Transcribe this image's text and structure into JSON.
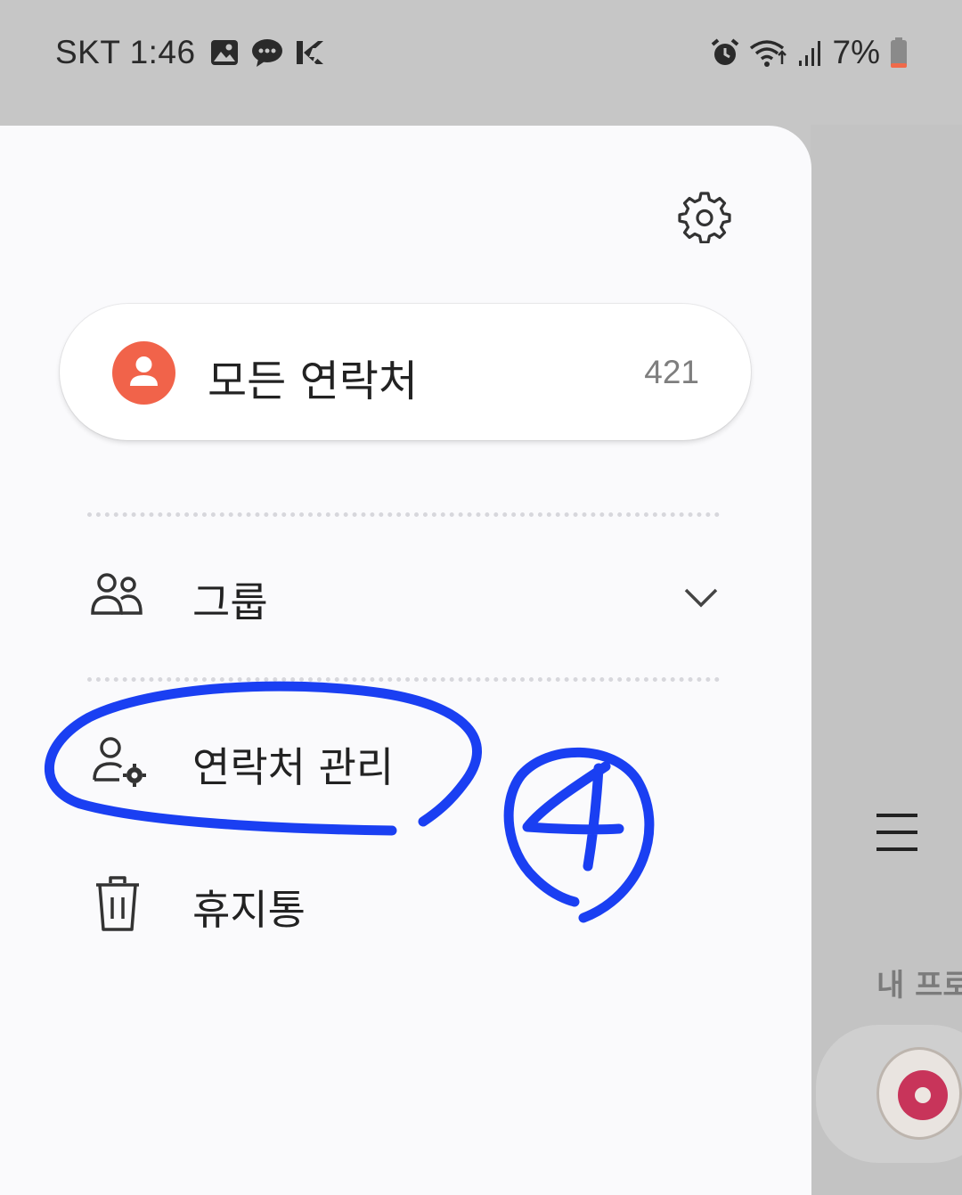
{
  "status_bar": {
    "carrier_time": "SKT 1:46",
    "battery_percent": "7%",
    "icons": [
      "gallery-icon",
      "chat-icon",
      "app-icon",
      "alarm-icon",
      "wifi-icon",
      "signal-icon",
      "battery-icon"
    ]
  },
  "drawer": {
    "settings_icon": "gear-icon",
    "all_contacts": {
      "label": "모든 연락처",
      "count": "421",
      "icon": "person-icon",
      "icon_color": "#f1634a"
    },
    "items": [
      {
        "label": "그룹",
        "icon": "group-icon",
        "expandable": true
      },
      {
        "label": "연락처 관리",
        "icon": "person-settings-icon"
      },
      {
        "label": "휴지통",
        "icon": "trash-icon"
      }
    ]
  },
  "background_app": {
    "menu_icon": "hamburger-icon",
    "my_profile_label": "내 프로"
  },
  "annotation": {
    "number": "4",
    "color": "#1a3ff2"
  }
}
